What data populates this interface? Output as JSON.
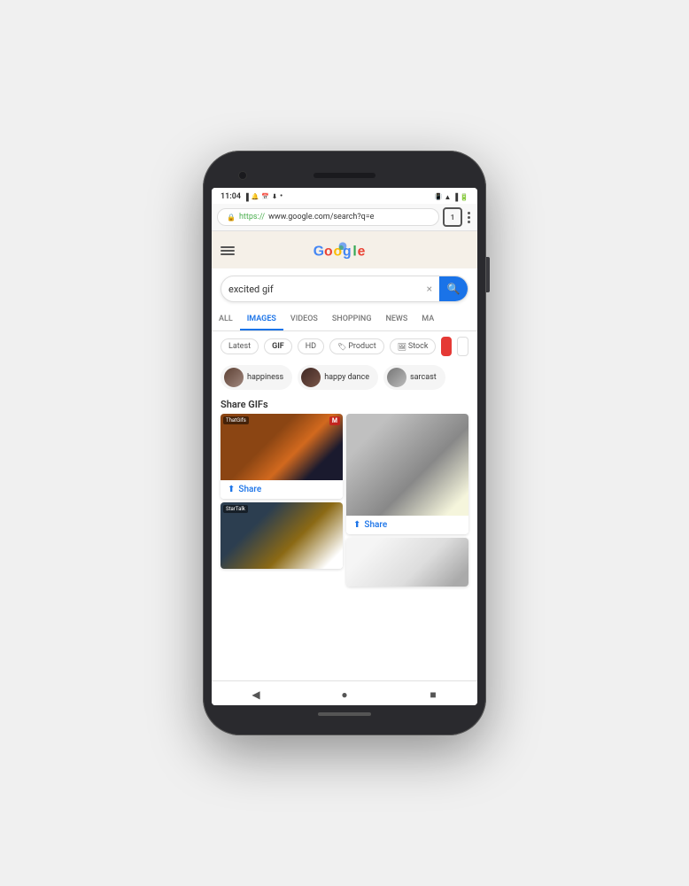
{
  "phone": {
    "status_bar": {
      "time": "11:04",
      "icons_left": [
        "signal",
        "wifi",
        "battery"
      ],
      "icons_right": [
        "vibrate",
        "wifi",
        "signal",
        "battery"
      ]
    },
    "url_bar": {
      "lock_icon": "🔒",
      "url_https": "https://",
      "url_rest": "www.google.com/search?q=e",
      "tab_count": "1",
      "menu_icon": "⋮"
    },
    "header": {
      "hamburger_label": "menu",
      "logo_alt": "Google Doodle"
    },
    "search": {
      "query": "excited gif",
      "clear_icon": "×",
      "search_icon": "🔍"
    },
    "tabs": [
      {
        "label": "ALL",
        "active": false
      },
      {
        "label": "IMAGES",
        "active": true
      },
      {
        "label": "VIDEOS",
        "active": false
      },
      {
        "label": "SHOPPING",
        "active": false
      },
      {
        "label": "NEWS",
        "active": false
      },
      {
        "label": "MA",
        "active": false
      }
    ],
    "filters": [
      {
        "label": "Latest",
        "type": "text"
      },
      {
        "label": "GIF",
        "type": "gif"
      },
      {
        "label": "HD",
        "type": "text"
      },
      {
        "label": "Product",
        "type": "tag",
        "icon": "🏷"
      },
      {
        "label": "Stock",
        "type": "tag",
        "icon": "🖼"
      },
      {
        "label": "",
        "type": "color-red"
      },
      {
        "label": "",
        "type": "color-white"
      }
    ],
    "suggestions": [
      {
        "label": "happiness",
        "avatar_class": "pill-avatar-1"
      },
      {
        "label": "happy dance",
        "avatar_class": "pill-avatar-2"
      },
      {
        "label": "sarcast",
        "avatar_class": "pill-avatar-3"
      }
    ],
    "share_gifs_label": "Share GIFs",
    "gifs": {
      "left_column": [
        {
          "badge_left": "ThatGifs",
          "badge_right": "M",
          "height": "75",
          "color_class": "gif1",
          "share_label": "Share"
        },
        {
          "badge_left": "StarTalk",
          "height": "75",
          "color_class": "gif3",
          "share_label": null
        }
      ],
      "right_column": [
        {
          "height": "110",
          "color_class": "gif2",
          "share_label": "Share"
        },
        {
          "height": "60",
          "color_class": "gif4",
          "share_label": null
        }
      ]
    },
    "nav_buttons": {
      "back": "◀",
      "home": "●",
      "recents": "■"
    }
  }
}
